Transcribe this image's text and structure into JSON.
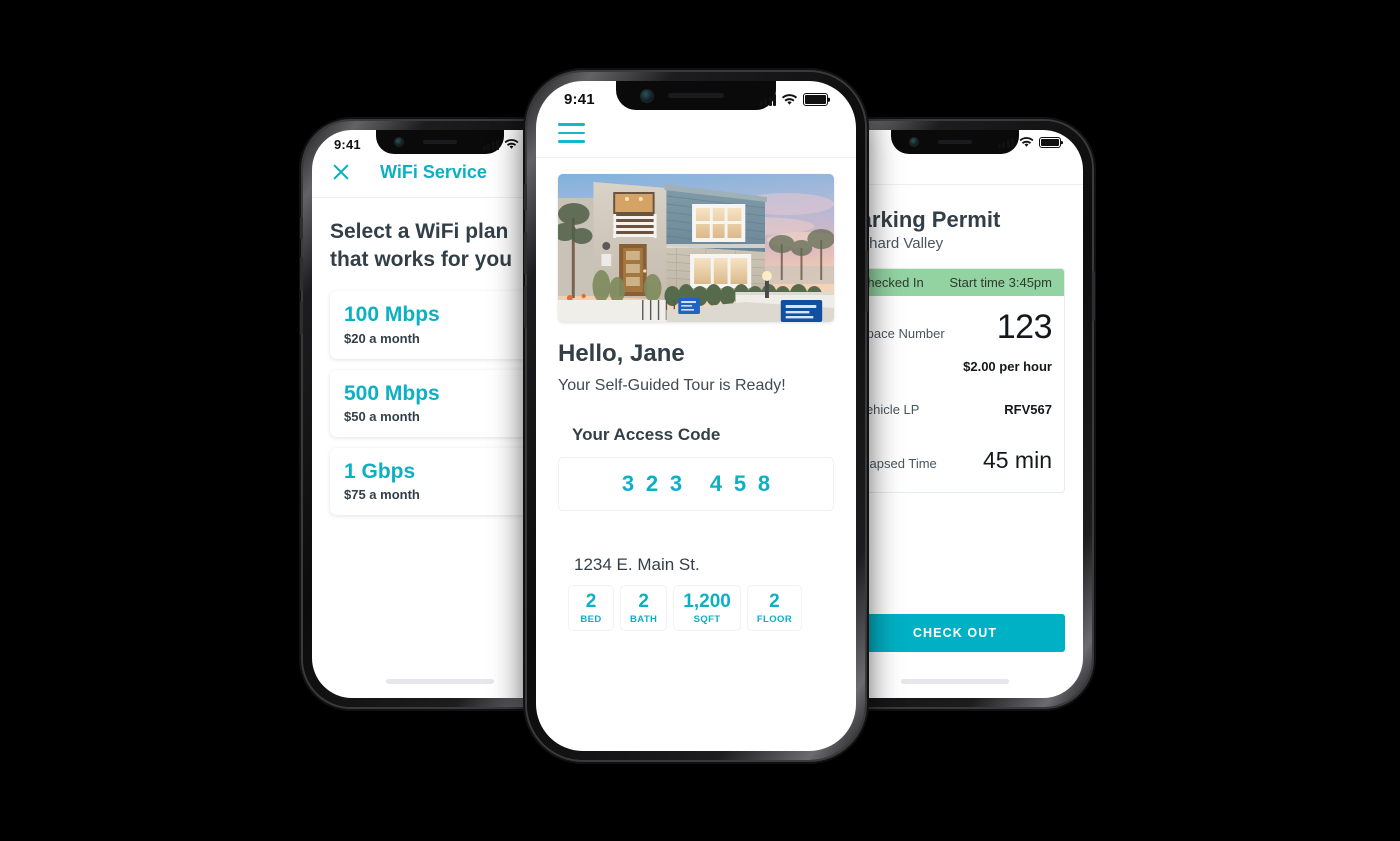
{
  "scene": {
    "background_color": "#000000",
    "accent_teal": "#0bb1c3",
    "status_green": "#93d3a2",
    "text_dark": "#333f48"
  },
  "left_phone": {
    "status_bar": {
      "time": "9:41",
      "cellular_icon": "signal-bars-icon",
      "wifi_icon": "wifi-icon",
      "battery_icon": "battery-icon"
    },
    "header": {
      "close_icon": "close-x-icon",
      "title": "WiFi Service"
    },
    "heading_line1": "Select a WiFi plan",
    "heading_line2": "that works for you",
    "plans": [
      {
        "speed": "100 Mbps",
        "price": "$20 a month"
      },
      {
        "speed": "500 Mbps",
        "price": "$50 a month"
      },
      {
        "speed": "1 Gbps",
        "price": "$75 a month"
      }
    ],
    "home_indicator": "home-indicator"
  },
  "center_phone": {
    "status_bar": {
      "time": "9:41",
      "cellular_icon": "signal-bars-icon",
      "wifi_icon": "wifi-icon",
      "battery_icon": "battery-icon"
    },
    "menu_icon": "hamburger-menu-icon",
    "photo_alt": "two-story-home-exterior-at-sunset",
    "greeting": "Hello, Jane",
    "greeting_sub": "Your Self-Guided Tour is Ready!",
    "code_label": "Your Access Code",
    "access_code_group_1": [
      "3",
      "2",
      "3"
    ],
    "access_code_group_2": [
      "4",
      "5",
      "8"
    ],
    "address": "1234 E. Main St.",
    "stats": [
      {
        "num": "2",
        "cap": "BED"
      },
      {
        "num": "2",
        "cap": "BATH"
      },
      {
        "num": "1,200",
        "cap": "SQFT"
      },
      {
        "num": "2",
        "cap": "FLOOR"
      }
    ]
  },
  "right_phone": {
    "status_bar": {
      "time": "",
      "cellular_icon": "signal-bars-icon",
      "wifi_icon": "wifi-icon",
      "battery_icon": "battery-icon"
    },
    "title": "Parking Permit",
    "subtitle": "Orchard Valley",
    "card_status": "Checked In",
    "card_start_time": "Start time 3:45pm",
    "rows": [
      {
        "label": "Space Number",
        "value": "123",
        "size": "xl"
      },
      {
        "label": "",
        "value": "$2.00 per hour",
        "size": "sm"
      },
      {
        "label": "Vehicle LP",
        "value": "RFV567",
        "size": "sm"
      },
      {
        "label": "Elapsed Time",
        "value": "45 min",
        "size": "lg"
      }
    ],
    "checkout_label": "CHECK OUT",
    "home_indicator": "home-indicator"
  }
}
